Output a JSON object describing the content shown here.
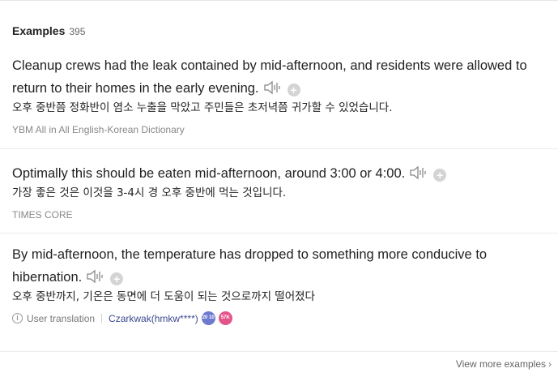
{
  "header": {
    "title": "Examples",
    "count": "395"
  },
  "examples": [
    {
      "en_line1": "Cleanup crews had the leak contained by mid-afternoon, and residents were allowed to",
      "en_line2": "return to their homes in the early evening.",
      "ko": "오후 중반쯤 정화반이 염소 누출을 막았고 주민들은 초저녁쯤 귀가할 수 있었습니다.",
      "source": "YBM All in All English-Korean Dictionary"
    },
    {
      "en_line1": "Optimally this should be eaten mid-afternoon, around 3:00 or 4:00.",
      "ko": "가장 좋은 것은 이것을 3-4시 경 오후 중반에 먹는 것입니다.",
      "source": "TIMES CORE"
    },
    {
      "en_line1": "By mid-afternoon, the temperature has dropped to something more conducive to",
      "en_line2": "hibernation.",
      "ko": "오후 중반까지, 기온은 동면에 더 도움이 되는 것으로까지 떨어졌다",
      "user_translation_label": "User translation",
      "user": "Czarkwak(hmkw****)",
      "level_badge": "20 10",
      "count_badge": "57K"
    }
  ],
  "footer": {
    "more_label": "View more examples"
  },
  "icons": {
    "speaker": "speaker-icon",
    "add": "plus-icon",
    "info": "info-icon",
    "chevron": "chevron-right-icon"
  }
}
